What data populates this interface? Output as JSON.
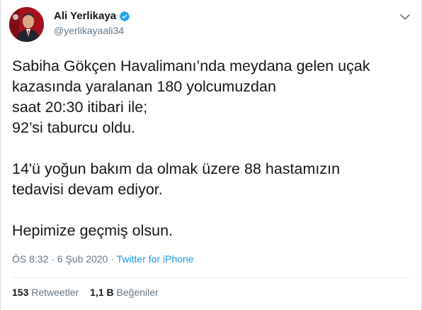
{
  "author": {
    "name": "Ali Yerlikaya",
    "handle": "@yerlikayaali34",
    "verified": true,
    "verified_color": "#1da1f2"
  },
  "tweet": {
    "lines": [
      "Sabiha Gökçen Havalimanı’nda meydana gelen uçak",
      "kazasında yaralanan 180 yolcumuzdan",
      "saat 20:30 itibari ile;",
      "92’si taburcu oldu.",
      "",
      "14'ü yoğun bakım da olmak üzere 88 hastamızın",
      "tedavisi devam ediyor.",
      "",
      "Hepimize geçmiş olsun."
    ],
    "time": "ÖS 8:32",
    "separator": " · ",
    "date": "6 Şub 2020",
    "source": "Twitter for iPhone"
  },
  "stats": {
    "retweets_count": "153",
    "retweets_label": "Retweetler",
    "likes_count": "1,1 B",
    "likes_label": "Beğeniler"
  },
  "icons": {
    "menu": "chevron-down-icon",
    "verified": "verified-badge-icon"
  },
  "colors": {
    "link": "#1b95e0",
    "secondary_text": "#657786",
    "primary_text": "#14171a"
  }
}
